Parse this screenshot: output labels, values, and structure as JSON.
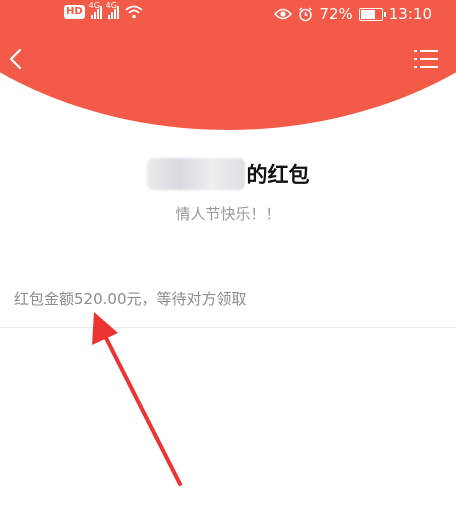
{
  "status_bar": {
    "hd_badge": "HD",
    "network_1": "4G",
    "network_2": "4G",
    "battery_percent": "72%",
    "battery_level": 0.72,
    "time": "13:10"
  },
  "header": {
    "back_icon": "chevron-left-icon",
    "menu_icon": "list-menu-icon",
    "background_color": "#f35b48"
  },
  "red_packet": {
    "title_suffix": "的红包",
    "greeting": "情人节快乐！！",
    "amount_status": "红包金额520.00元，等待对方领取"
  },
  "annotation": {
    "arrow_color": "#ee3333"
  }
}
